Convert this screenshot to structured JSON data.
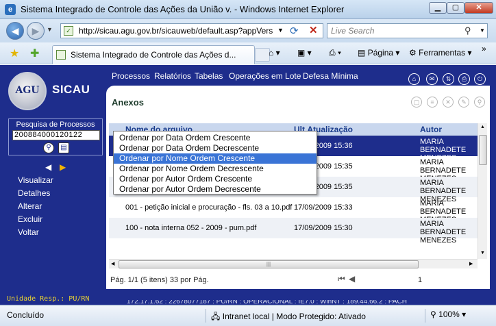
{
  "window": {
    "title": "Sistema Integrado de Controle das Ações da União v. - Windows Internet Explorer",
    "min_icon": "minimize-icon",
    "max_icon": "maximize-icon",
    "close_icon": "close-icon"
  },
  "address_bar": {
    "url": "http://sicau.agu.gov.br/sicauweb/default.asp?appVers",
    "search_placeholder": "Live Search"
  },
  "tab": {
    "label": "Sistema Integrado de Controle das Ações d..."
  },
  "commands": {
    "page": "Página",
    "tools": "Ferramentas"
  },
  "app": {
    "logo_text": "AGU",
    "name": "SICAU",
    "process_search": {
      "label": "Pesquisa de Processos",
      "value": "200884000120122"
    },
    "side_menu": [
      "Visualizar",
      "Detalhes",
      "Alterar",
      "Excluir",
      "Voltar"
    ],
    "unit": "Unidade Resp.: PU/RN",
    "top_nav": [
      "Processos",
      "Relatórios",
      "Tabelas",
      "Operações em Lote",
      "Defesa Mínima"
    ],
    "status_strip": "172.17.1.62 : 22678077187 : PU/RN : OPERACIONAL : IE7.0 : WinNT : 189.44.66.2 : PACH"
  },
  "panel": {
    "title": "Anexos",
    "columns": [
      "Nome do arquivo",
      "Ult.Atualização",
      "Autor"
    ],
    "rows": [
      {
        "name": "",
        "date": "17/09/2009 15:36",
        "author": "MARIA BERNADETE MENEZES",
        "selected": true
      },
      {
        "name": "",
        "date": "17/09/2009 15:35",
        "author": "MARIA BERNADETE MENEZES",
        "selected": false
      },
      {
        "name": "",
        "date": "17/09/2009 15:35",
        "author": "MARIA BERNADETE MENEZES",
        "selected": false
      },
      {
        "name": "001 - petição inicial e procuração - fls. 03 a 10.pdf",
        "date": "17/09/2009 15:33",
        "author": "MARIA BERNADETE MENEZES",
        "selected": false
      },
      {
        "name": "100 - nota interna 052 - 2009 - pum.pdf",
        "date": "17/09/2009 15:30",
        "author": "MARIA BERNADETE MENEZES",
        "selected": false
      }
    ],
    "footer": "Pág. 1/1 (5 itens) 33 por Pág.",
    "page_number": "1"
  },
  "context_menu": {
    "items": [
      "Ordenar por Data Ordem Crescente",
      "Ordenar por Data Ordem Decrescente",
      "Ordenar por Nome Ordem Crescente",
      "Ordenar por Nome Ordem Decrescente",
      "Ordenar por Autor Ordem Crescente",
      "Ordenar por Autor Ordem Decrescente"
    ],
    "highlighted_index": 2
  },
  "status_bar": {
    "status": "Concluído",
    "zone": "Intranet local | Modo Protegido: Ativado",
    "zoom": "100%"
  },
  "colors": {
    "app_background": "#1e2d8c",
    "selected_row": "#1e2d8c",
    "menu_highlight": "#3a74d6",
    "unit_text": "#e9d233"
  }
}
